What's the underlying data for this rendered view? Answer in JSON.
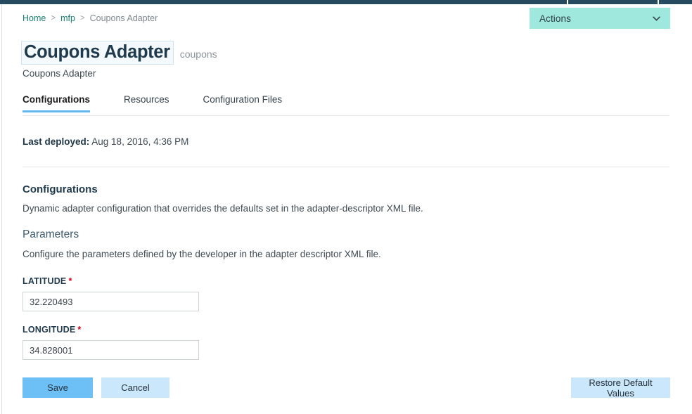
{
  "topbar": {
    "color": "#264a60",
    "segments": [
      806,
      2,
      127,
      2,
      47
    ]
  },
  "actions": {
    "label": "Actions",
    "icon": "chevron-down-icon",
    "color": "#9fe8dd"
  },
  "breadcrumb": {
    "items": [
      {
        "label": "Home",
        "link": true
      },
      {
        "label": "mfp",
        "link": true
      },
      {
        "label": "Coupons Adapter",
        "link": false
      }
    ],
    "separator": ">",
    "link_color": "#1a7f73"
  },
  "header": {
    "title": "Coupons Adapter",
    "subtitle": "coupons",
    "description": "Coupons Adapter"
  },
  "tabs": [
    {
      "label": "Configurations",
      "active": true
    },
    {
      "label": "Resources",
      "active": false
    },
    {
      "label": "Configuration Files",
      "active": false
    }
  ],
  "deployed": {
    "label": "Last deployed:",
    "value": "Aug 18, 2016, 4:36 PM"
  },
  "section": {
    "title": "Configurations",
    "description": "Dynamic adapter configuration that overrides the defaults set in the adapter-descriptor XML file.",
    "sub_title": "Parameters",
    "sub_description": "Configure the parameters defined by the developer in the adapter descriptor XML file."
  },
  "fields": [
    {
      "label": "LATITUDE",
      "required": true,
      "value": "32.220493",
      "placeholder": ""
    },
    {
      "label": "LONGITUDE",
      "required": true,
      "value": "34.828001",
      "placeholder": ""
    }
  ],
  "buttons": {
    "save": "Save",
    "cancel": "Cancel",
    "restore": "Restore Default Values",
    "save_color": "#6cc0f5",
    "secondary_color": "#cbe7fb"
  },
  "required_marker": "*"
}
